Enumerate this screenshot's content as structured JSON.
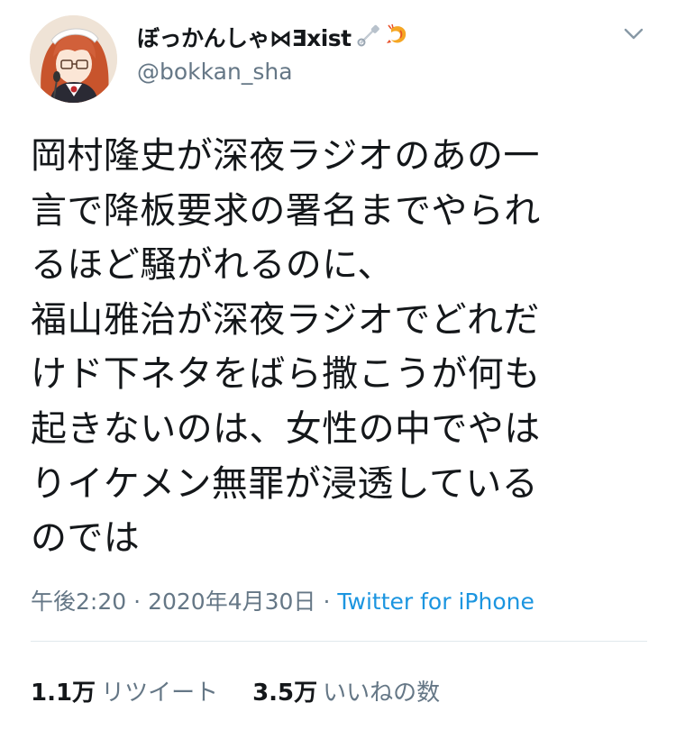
{
  "user": {
    "display_name": "ぼっかんしゃ⋈Ǝxist",
    "handle": "@bokkan_sha",
    "name_icons": [
      "safety-pin-icon",
      "shrimp-icon"
    ]
  },
  "tweet": {
    "lines": [
      "岡村隆史が深夜ラジオのあの一",
      "言で降板要求の署名までやられ",
      "るほど騒がれるのに、",
      "福山雅治が深夜ラジオでどれだ",
      "けド下ネタをばら撒こうが何も",
      "起きないのは、女性の中でやは",
      "りイケメン無罪が浸透している",
      "のでは"
    ],
    "time": "午後2:20",
    "date": "2020年4月30日",
    "separator": "·",
    "source": "Twitter for iPhone"
  },
  "stats": {
    "retweets_count": "1.1万",
    "retweets_label": "リツイート",
    "likes_count": "3.5万",
    "likes_label": "いいねの数"
  },
  "colors": {
    "text": "#14171a",
    "secondary": "#657786",
    "link": "#1b95e0",
    "divider": "#e1e8ed"
  }
}
